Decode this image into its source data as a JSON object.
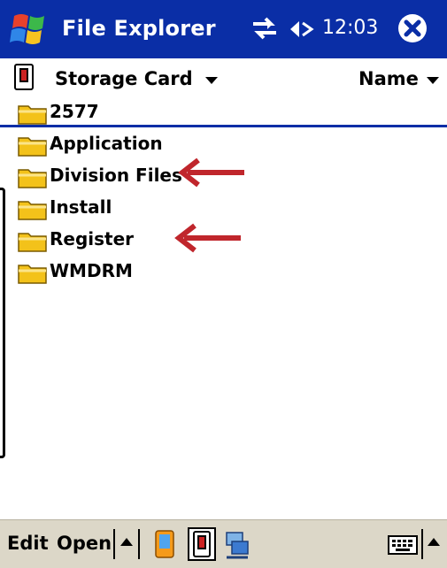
{
  "title_bar": {
    "app_title": "File Explorer",
    "clock": "12:03",
    "icons": [
      "windows-start-icon",
      "connectivity-icon",
      "volume-icon",
      "close-icon"
    ]
  },
  "location_bar": {
    "location": "Storage Card",
    "sort_by": "Name",
    "icons": [
      "storage-card-icon",
      "chevron-down-icon"
    ]
  },
  "files": [
    {
      "name": "2577"
    },
    {
      "name": "Application"
    },
    {
      "name": "Division Files"
    },
    {
      "name": "Install"
    },
    {
      "name": "Register"
    },
    {
      "name": "WMDRM"
    }
  ],
  "annotations": {
    "arrow_color": "#c0262c",
    "marked_items": [
      "Division Files",
      "Register"
    ]
  },
  "menu_bar": {
    "edit_label": "Edit",
    "open_label": "Open",
    "icons": [
      "up-arrow-icon",
      "my-device-icon",
      "storage-card-icon",
      "network-icon",
      "keyboard-icon",
      "up-arrow-icon"
    ]
  },
  "colors": {
    "title_bar": "#0a2ea6",
    "menu_bar": "#dcd7c8",
    "folder": "#f3c21a"
  }
}
